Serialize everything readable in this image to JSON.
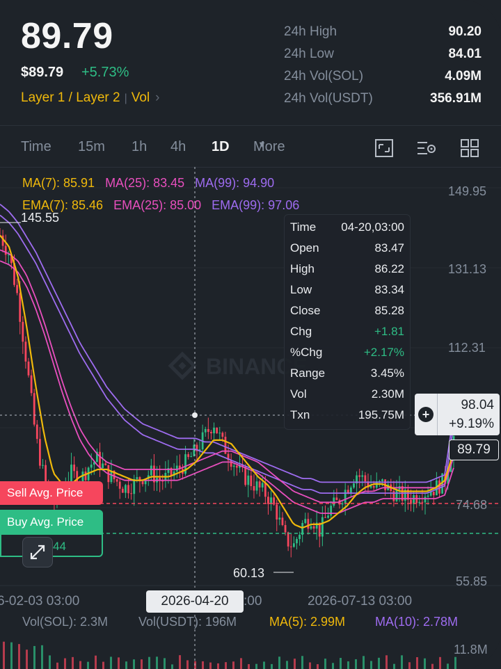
{
  "header": {
    "last_price": "89.79",
    "price_usd": "$89.79",
    "change_pct": "+5.73%",
    "tag_layer": "Layer 1 / Layer 2",
    "tag_vol": "Vol",
    "stats": [
      {
        "label": "24h High",
        "value": "90.20"
      },
      {
        "label": "24h Low",
        "value": "84.01"
      },
      {
        "label": "24h Vol(SOL)",
        "value": "4.09M"
      },
      {
        "label": "24h Vol(USDT)",
        "value": "356.91M"
      }
    ]
  },
  "timeframes": {
    "time": "Time",
    "m15": "15m",
    "h1": "1h",
    "h4": "4h",
    "d1": "1D",
    "more": "More"
  },
  "indicators": {
    "ma7": "MA(7): 85.91",
    "ma25": "MA(25): 83.45",
    "ma99": "MA(99): 94.90",
    "ema7": "EMA(7): 85.46",
    "ema25": "EMA(25): 85.00",
    "ema99": "EMA(99): 97.06"
  },
  "tooltip": [
    {
      "label": "Time",
      "value": "04-20,03:00",
      "color": "#eaecef"
    },
    {
      "label": "Open",
      "value": "83.47",
      "color": "#eaecef"
    },
    {
      "label": "High",
      "value": "86.22",
      "color": "#eaecef"
    },
    {
      "label": "Low",
      "value": "83.34",
      "color": "#eaecef"
    },
    {
      "label": "Close",
      "value": "85.28",
      "color": "#eaecef"
    },
    {
      "label": "Chg",
      "value": "+1.81",
      "color": "#2ebd85"
    },
    {
      "label": "%Chg",
      "value": "+2.17%",
      "color": "#2ebd85"
    },
    {
      "label": "Range",
      "value": "3.45%",
      "color": "#eaecef"
    },
    {
      "label": "Vol",
      "value": "2.30M",
      "color": "#eaecef"
    },
    {
      "label": "Txn",
      "value": "195.75M",
      "color": "#eaecef"
    }
  ],
  "axis": {
    "y_labels": [
      "149.95",
      "131.13",
      "112.31",
      "74.68",
      "55.85"
    ],
    "max_label": "145.55",
    "min_label": "60.13",
    "x_left": "6-02-03 03:00",
    "x_highlight": "2026-04-20",
    "x_highlight_tail": ":00",
    "x_right": "2026-07-13 03:00",
    "vol_axis_label": "11.8M"
  },
  "crosshair": {
    "price": "98.04",
    "pct": "+9.19%"
  },
  "last_price_tag": "89.79",
  "orders": {
    "sell_label": "Sell Avg. Price",
    "buy_label": "Buy Avg. Price",
    "buy_value": "44"
  },
  "volume": {
    "sol": "Vol(SOL): 2.3M",
    "usdt": "Vol(USDT): 196M",
    "ma5": "MA(5): 2.99M",
    "ma10": "MA(10): 2.78M"
  },
  "watermark": "BINANCE",
  "colors": {
    "up": "#2ebd85",
    "down": "#f6465d",
    "ma7": "#f0b90b",
    "ma25": "#e84fbe",
    "ma99": "#9e6cf0",
    "accent": "#f0b90b"
  },
  "chart_data": {
    "type": "candlestick",
    "close_path": [
      145,
      140,
      128,
      110,
      90,
      78,
      72,
      76,
      80,
      78,
      82,
      84,
      80,
      78,
      76,
      77,
      79,
      80,
      78,
      79,
      81,
      83,
      86,
      90,
      94,
      88,
      84,
      80,
      78,
      76,
      74,
      70,
      62,
      60,
      66,
      68,
      64,
      70,
      72,
      76,
      80,
      78,
      76,
      77,
      75,
      74,
      73,
      74,
      75,
      76,
      78,
      89.79
    ],
    "ma7_path": [
      145,
      142,
      134,
      120,
      104,
      90,
      80,
      77,
      77,
      79,
      80,
      81,
      81,
      80,
      79,
      78,
      78,
      79,
      79,
      79,
      80,
      81,
      83,
      86,
      89,
      89,
      88,
      85,
      82,
      79,
      77,
      74,
      70,
      66,
      65,
      66,
      66,
      67,
      69,
      71,
      74,
      76,
      77,
      77,
      76,
      75,
      75,
      75,
      75,
      76,
      78,
      85.91
    ],
    "ma25_path": [
      140,
      139,
      137,
      133,
      127,
      120,
      112,
      104,
      97,
      91,
      87,
      84,
      82,
      81,
      80,
      80,
      80,
      80,
      80,
      80,
      80,
      81,
      82,
      83,
      84,
      85,
      85,
      84,
      83,
      82,
      80,
      78,
      76,
      74,
      73,
      72,
      71,
      71,
      71,
      72,
      73,
      74,
      74,
      75,
      75,
      75,
      75,
      75,
      75,
      75,
      76,
      83.45
    ],
    "ma99_path": [
      152,
      150,
      147,
      143,
      139,
      134,
      129,
      124,
      119,
      114,
      110,
      106,
      102,
      99,
      96,
      94,
      92,
      91,
      90,
      89,
      88,
      88,
      88,
      87,
      87,
      86,
      85,
      84,
      83,
      82,
      81,
      80,
      79,
      78,
      77,
      77,
      76,
      76,
      76,
      76,
      76,
      76,
      76,
      76,
      76,
      76,
      76,
      76,
      76,
      77,
      78,
      94.9
    ],
    "ylim": [
      50,
      158
    ]
  }
}
